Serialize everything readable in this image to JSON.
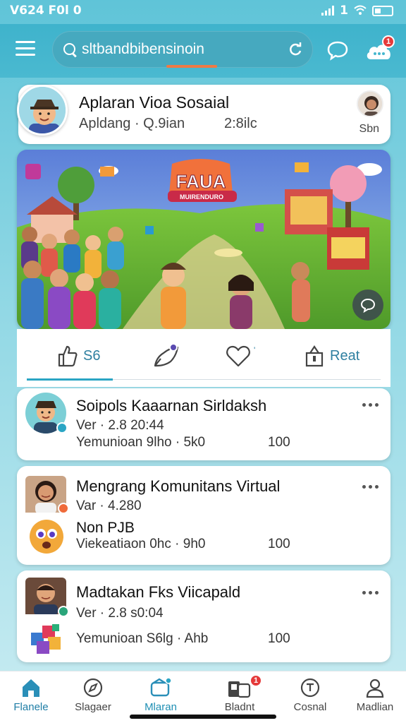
{
  "status_bar": {
    "time": "V624 F0l 0",
    "indicator": "1"
  },
  "top_bar": {
    "search_text": "sltbandbibensinoin"
  },
  "profile": {
    "title": "Aplaran Vioa Sosaial",
    "subtitle": "Apldang · Q.9ian",
    "time": "2:8ilc",
    "mini_label": "Sbn"
  },
  "hero": {
    "banner_text": "FAUA",
    "banner_subtext": "MUIRENDURO"
  },
  "actions": {
    "like_count": "S6",
    "repost_label": "Reat"
  },
  "feed": [
    {
      "title": "Soipols Kaaarnan Sirldaksh",
      "meta": "Ver · 2.8 20:44",
      "stat": "Yemunioan 9lho · 5k0",
      "count": "100"
    },
    {
      "title": "Mengrang  Komunitans Virtual",
      "meta": "Var · 4.280",
      "sub": "Non PJB",
      "stat": "Viekeatiaon 0hc · 9h0",
      "count": "100"
    },
    {
      "title": "Madtakan Fks Viicapald",
      "meta": "Ver · 2.8 s0:04",
      "stat": "Yemunioan S6lg · Ahb",
      "count": "100"
    }
  ],
  "nav": [
    {
      "label": "Flanele",
      "icon": "home-icon"
    },
    {
      "label": "Slagaer",
      "icon": "compass-icon"
    },
    {
      "label": "Mlaran",
      "icon": "chat-icon"
    },
    {
      "label": "Bladnt",
      "icon": "inbox-icon",
      "badge": "1"
    },
    {
      "label": "Cosnal",
      "icon": "clock-icon"
    },
    {
      "label": "Madlian",
      "icon": "profile-icon"
    }
  ],
  "badges": {
    "notif": "1"
  },
  "colors": {
    "accent": "#2aa5c4",
    "header": "#45b7ce",
    "badge": "#e53a3a"
  }
}
